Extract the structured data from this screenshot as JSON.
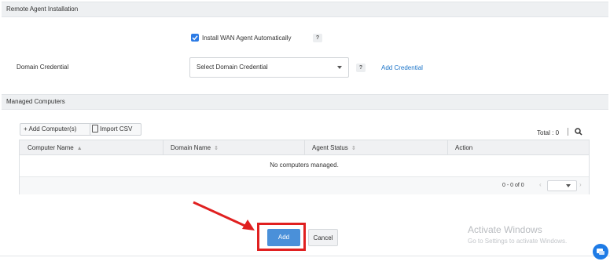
{
  "remote_agent": {
    "section_title": "Remote Agent Installation",
    "checkbox_label": "Install WAN Agent Automatically",
    "checkbox_checked": true,
    "help_text": "?",
    "domain_credential_label": "Domain Credential",
    "select_value": "Select Domain Credential",
    "add_credential_link": "Add Credential"
  },
  "managed_computers": {
    "section_title": "Managed Computers",
    "add_button": "+ Add Computer(s)",
    "import_button": "Import CSV",
    "total_text": "Total : 0",
    "columns": [
      "Computer Name",
      "Domain Name",
      "Agent Status",
      "Action"
    ],
    "empty_message": "No computers managed.",
    "pagination_text": "0 - 0 of 0"
  },
  "actions": {
    "add_label": "Add",
    "cancel_label": "Cancel"
  },
  "watermark": {
    "line1": "Activate Windows",
    "line2": "Go to Settings to activate Windows."
  },
  "colors": {
    "primary_button": "#4a90d9",
    "highlight": "#e02020",
    "link": "#1a73c8"
  }
}
